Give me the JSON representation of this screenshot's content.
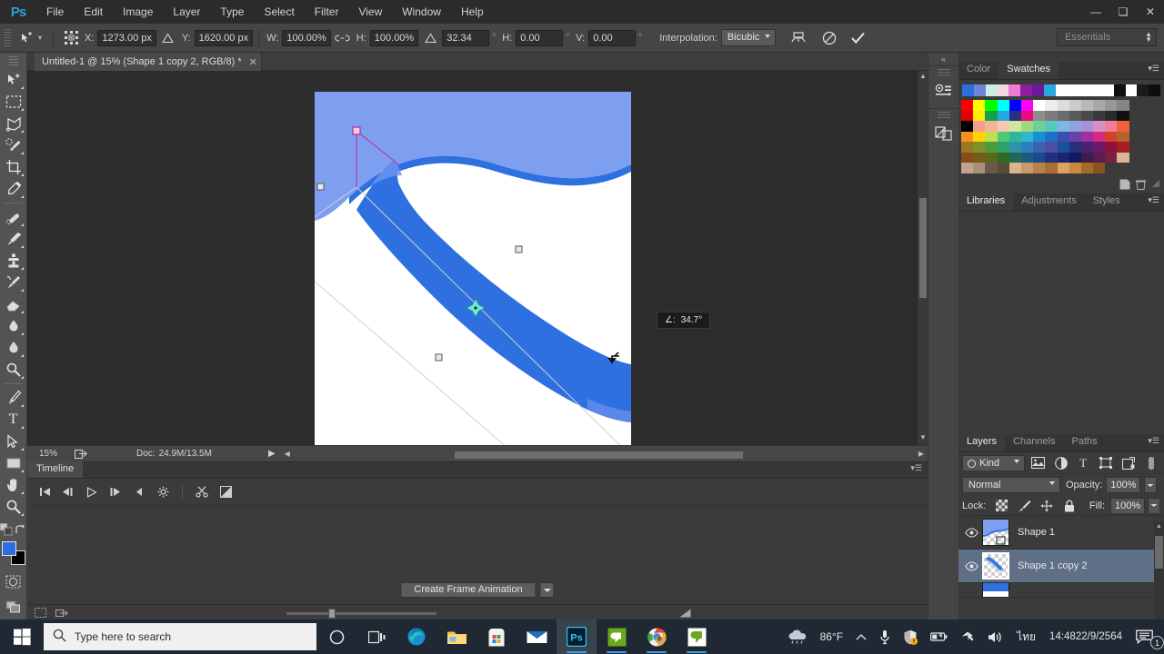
{
  "app": {
    "logo": "Ps",
    "menus": [
      "File",
      "Edit",
      "Image",
      "Layer",
      "Type",
      "Select",
      "Filter",
      "View",
      "Window",
      "Help"
    ],
    "window_controls": {
      "minimize": "minimize-icon",
      "restore": "restore-icon",
      "close": "close-icon"
    },
    "workspace": "Essentials"
  },
  "options_bar": {
    "tool_icon": "move-tool-icon",
    "preset_icon": "transform-reference-point-icon",
    "x_label": "X:",
    "x_value": "1273.00 px",
    "delta_icon_1": "delta-icon",
    "y_label": "Y:",
    "y_value": "1620.00 px",
    "w_label": "W:",
    "w_value": "100.00%",
    "link_icon": "link-icon",
    "h_label": "H:",
    "h_value": "100.00%",
    "angle_icon": "angle-icon",
    "angle_value": "32.34",
    "degree": "°",
    "hskew_label": "H:",
    "hskew_value": "0.00",
    "vskew_label": "V:",
    "vskew_value": "0.00",
    "interpolation_label": "Interpolation:",
    "interpolation_value": "Bicubic",
    "warp_icon": "warp-icon",
    "cancel_icon": "cancel-transform-icon",
    "commit_icon": "commit-transform-icon"
  },
  "toolbar": {
    "tools": [
      {
        "name": "move-tool-icon",
        "has_flyout": true
      },
      {
        "name": "rectangular-marquee-tool-icon",
        "has_flyout": true
      },
      {
        "name": "lasso-tool-icon",
        "has_flyout": true
      },
      {
        "name": "quick-selection-tool-icon",
        "has_flyout": true
      },
      {
        "name": "crop-tool-icon",
        "has_flyout": true
      },
      {
        "name": "eyedropper-tool-icon",
        "has_flyout": true
      },
      {
        "name": "spot-healing-brush-tool-icon",
        "has_flyout": true
      },
      {
        "name": "brush-tool-icon",
        "has_flyout": true
      },
      {
        "name": "clone-stamp-tool-icon",
        "has_flyout": true
      },
      {
        "name": "history-brush-tool-icon",
        "has_flyout": true
      },
      {
        "name": "eraser-tool-icon",
        "has_flyout": true
      },
      {
        "name": "gradient-tool-icon",
        "has_flyout": true
      },
      {
        "name": "blur-tool-icon",
        "has_flyout": true
      },
      {
        "name": "dodge-tool-icon",
        "has_flyout": true
      },
      {
        "name": "pen-tool-icon",
        "has_flyout": true
      },
      {
        "name": "type-tool-icon",
        "has_flyout": true
      },
      {
        "name": "path-selection-tool-icon",
        "has_flyout": true
      },
      {
        "name": "rectangle-tool-icon",
        "has_flyout": true
      },
      {
        "name": "hand-tool-icon",
        "has_flyout": true
      },
      {
        "name": "zoom-tool-icon",
        "has_flyout": true
      }
    ],
    "default_colors_icon": "default-colors-icon",
    "swap_colors_icon": "swap-colors-icon",
    "foreground_color": "#2a6ee0",
    "background_color": "#000000",
    "quick_mask_icon": "quick-mask-icon",
    "screen_mode_icon": "screen-mode-icon"
  },
  "document": {
    "tab_title": "Untitled-1 @ 15% (Shape 1 copy 2, RGB/8) *",
    "close_icon": "close-tab-icon",
    "zoom_level": "15%",
    "doc_info_label": "Doc:",
    "doc_info_value": "24.9M/13.5M",
    "share_icon": "share-icon",
    "rotation_tooltip_label": "∠:",
    "rotation_tooltip_value": "34.7°",
    "artboard_bg": "#ffffff",
    "shape_light_blue": "#7e9ff0",
    "shape_blue": "#2f70e0",
    "canvas_bg": "#2c2c2c"
  },
  "timeline": {
    "tab": "Timeline",
    "panel_menu_icon": "panel-menu-icon",
    "buttons": [
      {
        "name": "go-to-first-frame-button"
      },
      {
        "name": "previous-frame-button"
      },
      {
        "name": "play-button"
      },
      {
        "name": "next-frame-button"
      },
      {
        "name": "audio-mute-button"
      },
      {
        "name": "set-playback-options-button"
      },
      {
        "name": "split-at-playhead-button"
      },
      {
        "name": "transition-button"
      }
    ],
    "create_frame_animation_label": "Create Frame Animation",
    "dropdown_icon": "chevron-down-icon",
    "footer_icons": [
      "convert-to-frame-animation-icon",
      "render-video-icon"
    ]
  },
  "dock_strip": {
    "collapse_icon": "collapse-panels-icon",
    "icons": [
      "history-icon",
      "properties-icon"
    ]
  },
  "color_panel": {
    "tabs": [
      {
        "label": "Color",
        "active": false
      },
      {
        "label": "Swatches",
        "active": true
      }
    ],
    "panel_menu_icon": "panel-menu-icon",
    "recent_swatches": [
      "#2a6ee0",
      "#6f86d8",
      "#c8f0e2",
      "#f6d7e0",
      "#f07ad3",
      "#8c1f9c",
      "#6a1a9a",
      "#29a8e0",
      "#ffffff",
      "#ffffff",
      "#ffffff",
      "#ffffff",
      "#ffffff",
      "#111111",
      "#ffffff",
      "#1a1a1a",
      "#0d0d0d"
    ],
    "swatch_rows": [
      [
        "#ff0000",
        "#ffff00",
        "#00ff00",
        "#00ffff",
        "#0000ff",
        "#ff00ff",
        "#ffffff",
        "#ededed",
        "#dcdcdc",
        "#cbcbcb",
        "#b9b9b9",
        "#a8a8a8",
        "#979797",
        "#868686",
        "#e60000",
        "#ffee00"
      ],
      [
        "#12a34a",
        "#29a8e0",
        "#2b2f80",
        "#ee0a7e",
        "#8d8d8d",
        "#7c7c7c",
        "#6b6b6b",
        "#5a5a5a",
        "#4a4a4a",
        "#3a3a3a",
        "#2a2a2a",
        "#111111",
        "#000000",
        "#f0a08c",
        "#f2b49a",
        "#f5c9ae"
      ],
      [
        "#cfe8a0",
        "#9ed97e",
        "#6fcf9a",
        "#57c8c0",
        "#7fb6e8",
        "#8fa2e0",
        "#a88fd8",
        "#d98fc4",
        "#ef7f96",
        "#f2603c",
        "#f7921e",
        "#ffd400",
        "#bfe04a",
        "#4fc878",
        "#2fb79e",
        "#32b7c9"
      ],
      [
        "#1b8fd6",
        "#1f6fc4",
        "#3a4fb0",
        "#6a3fa8",
        "#a0309b",
        "#d42a7f",
        "#d6412a",
        "#b5622a",
        "#9b7a1f",
        "#7f8f2a",
        "#4f9b3a",
        "#2fa06a",
        "#2f94a8",
        "#2f7fc0",
        "#3a63b0",
        "#4a4fa0"
      ],
      [
        "#1b4f9c",
        "#2b2f80",
        "#4a2370",
        "#6a1a6a",
        "#8c1242",
        "#a52020",
        "#8a4a1a",
        "#7a5a1a",
        "#5a6a1a",
        "#2f6a2a",
        "#1f6a55",
        "#1f5a7a",
        "#1a4a8c",
        "#22307e",
        "#1a2470",
        "#101a60"
      ],
      [
        "#3a1f4a",
        "#5a1f50",
        "#7a2040",
        "#d8b49a",
        "#c2a48c",
        "#a89078",
        "#6a5a4a",
        "#5a4a3a",
        "#d9b48c",
        "#c89a6a",
        "#b8834a",
        "#a87030",
        "#e0a060",
        "#c98a40",
        "#a86a28",
        "#8a5420"
      ]
    ]
  },
  "libraries_panel": {
    "toolbar_icons": [
      "new-item-icon",
      "delete-icon",
      "grip-icon"
    ],
    "tabs": [
      {
        "label": "Libraries",
        "active": true
      },
      {
        "label": "Adjustments",
        "active": false
      },
      {
        "label": "Styles",
        "active": false
      }
    ],
    "panel_menu_icon": "panel-menu-icon"
  },
  "layers_panel": {
    "tabs": [
      {
        "label": "Layers",
        "active": true
      },
      {
        "label": "Channels",
        "active": false
      },
      {
        "label": "Paths",
        "active": false
      }
    ],
    "panel_menu_icon": "panel-menu-icon",
    "filter_kind": "Kind",
    "filter_icons": [
      "filter-pixel-icon",
      "filter-adjustment-icon",
      "filter-type-icon",
      "filter-shape-icon",
      "filter-smart-object-icon"
    ],
    "filter_toggle_icon": "filter-toggle-icon",
    "blend_mode": "Normal",
    "opacity_label": "Opacity:",
    "opacity_value": "100%",
    "lock_label": "Lock:",
    "lock_icons": [
      "lock-transparent-pixels-icon",
      "lock-image-pixels-icon",
      "lock-position-icon",
      "lock-all-icon"
    ],
    "fill_label": "Fill:",
    "fill_value": "100%",
    "layers": [
      {
        "name": "Shape 1",
        "visible": true,
        "selected": false,
        "eye_icon": "eye-icon",
        "thumb": "shape-thumbnail"
      },
      {
        "name": "Shape 1 copy 2",
        "visible": true,
        "selected": true,
        "eye_icon": "eye-icon",
        "thumb": "shape-thumbnail"
      }
    ],
    "footer_icons": [
      "link-layers-icon",
      "layer-style-icon",
      "layer-mask-icon",
      "adjustment-layer-icon",
      "new-group-icon",
      "new-layer-icon",
      "delete-layer-icon"
    ],
    "scroll_up_icon": "scroll-up-icon",
    "scroll_down_icon": "scroll-down-icon"
  },
  "taskbar": {
    "start_icon": "windows-start-icon",
    "search_icon": "search-icon",
    "search_placeholder": "Type here to search",
    "cortana_icon": "cortana-icon",
    "task_view_icon": "task-view-icon",
    "apps": [
      {
        "name": "microsoft-edge-icon",
        "running": false
      },
      {
        "name": "file-explorer-icon",
        "running": false
      },
      {
        "name": "microsoft-store-icon",
        "running": false
      },
      {
        "name": "mail-icon",
        "running": false
      },
      {
        "name": "photoshop-icon",
        "running": true,
        "active": true
      },
      {
        "name": "camtasia-icon",
        "running": true
      },
      {
        "name": "google-chrome-icon",
        "running": true
      },
      {
        "name": "camtasia-editor-icon",
        "running": true
      }
    ],
    "weather_icon": "rain-cloud-icon",
    "temperature": "86°F",
    "tray_expand_icon": "show-hidden-icons-icon",
    "tray_icons": [
      "microphone-icon",
      "windows-security-icon",
      "battery-icon",
      "network-icon",
      "volume-icon"
    ],
    "language": "ไทย",
    "time": "14:48",
    "date": "22/9/2564",
    "notification_icon": "notifications-icon",
    "notification_count": "1"
  }
}
